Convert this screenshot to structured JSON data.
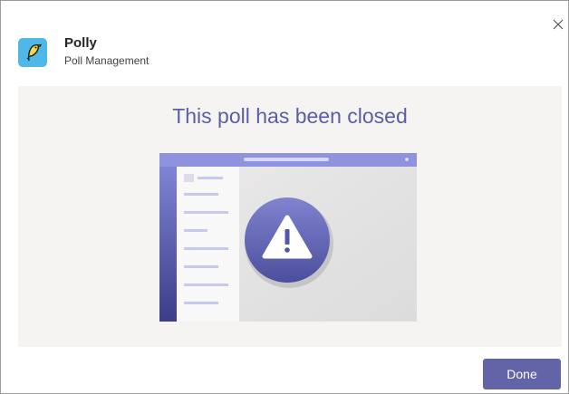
{
  "app": {
    "name": "Polly",
    "subtitle": "Poll Management",
    "icon": "polly-bird-icon"
  },
  "main": {
    "message": "This poll has been closed",
    "illustration": "closed-poll-warning-illustration"
  },
  "footer": {
    "done_label": "Done"
  },
  "colors": {
    "accent": "#6264a7",
    "heading": "#5b5ea6",
    "app_icon_bg": "#4fb8e8",
    "content_bg": "#f5f4f3"
  }
}
